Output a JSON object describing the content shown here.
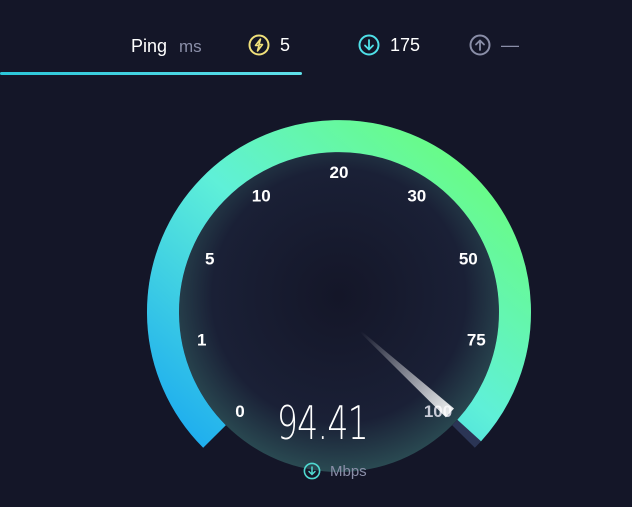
{
  "header": {
    "ping_label": "Ping",
    "ping_unit": "ms",
    "jitter_value": "5",
    "download_value": "175",
    "upload_value": "—"
  },
  "gauge": {
    "ticks": [
      "0",
      "1",
      "5",
      "10",
      "20",
      "30",
      "50",
      "75",
      "100"
    ],
    "needle_fraction": 0.99,
    "speed_value": "94.41",
    "unit": "Mbps"
  },
  "colors": {
    "background": "#141628",
    "arc_start": "#1aa9f0",
    "arc_mid": "#5ff0d8",
    "arc_end": "#6cff6e",
    "jitter_icon": "#f0e07a",
    "download_icon": "#4fe0e8",
    "upload_icon": "#8a8ea8"
  },
  "icons": {
    "jitter": "jitter-bolt-icon",
    "download": "download-arrow-icon",
    "upload": "upload-arrow-icon",
    "unit": "download-arrow-icon"
  }
}
